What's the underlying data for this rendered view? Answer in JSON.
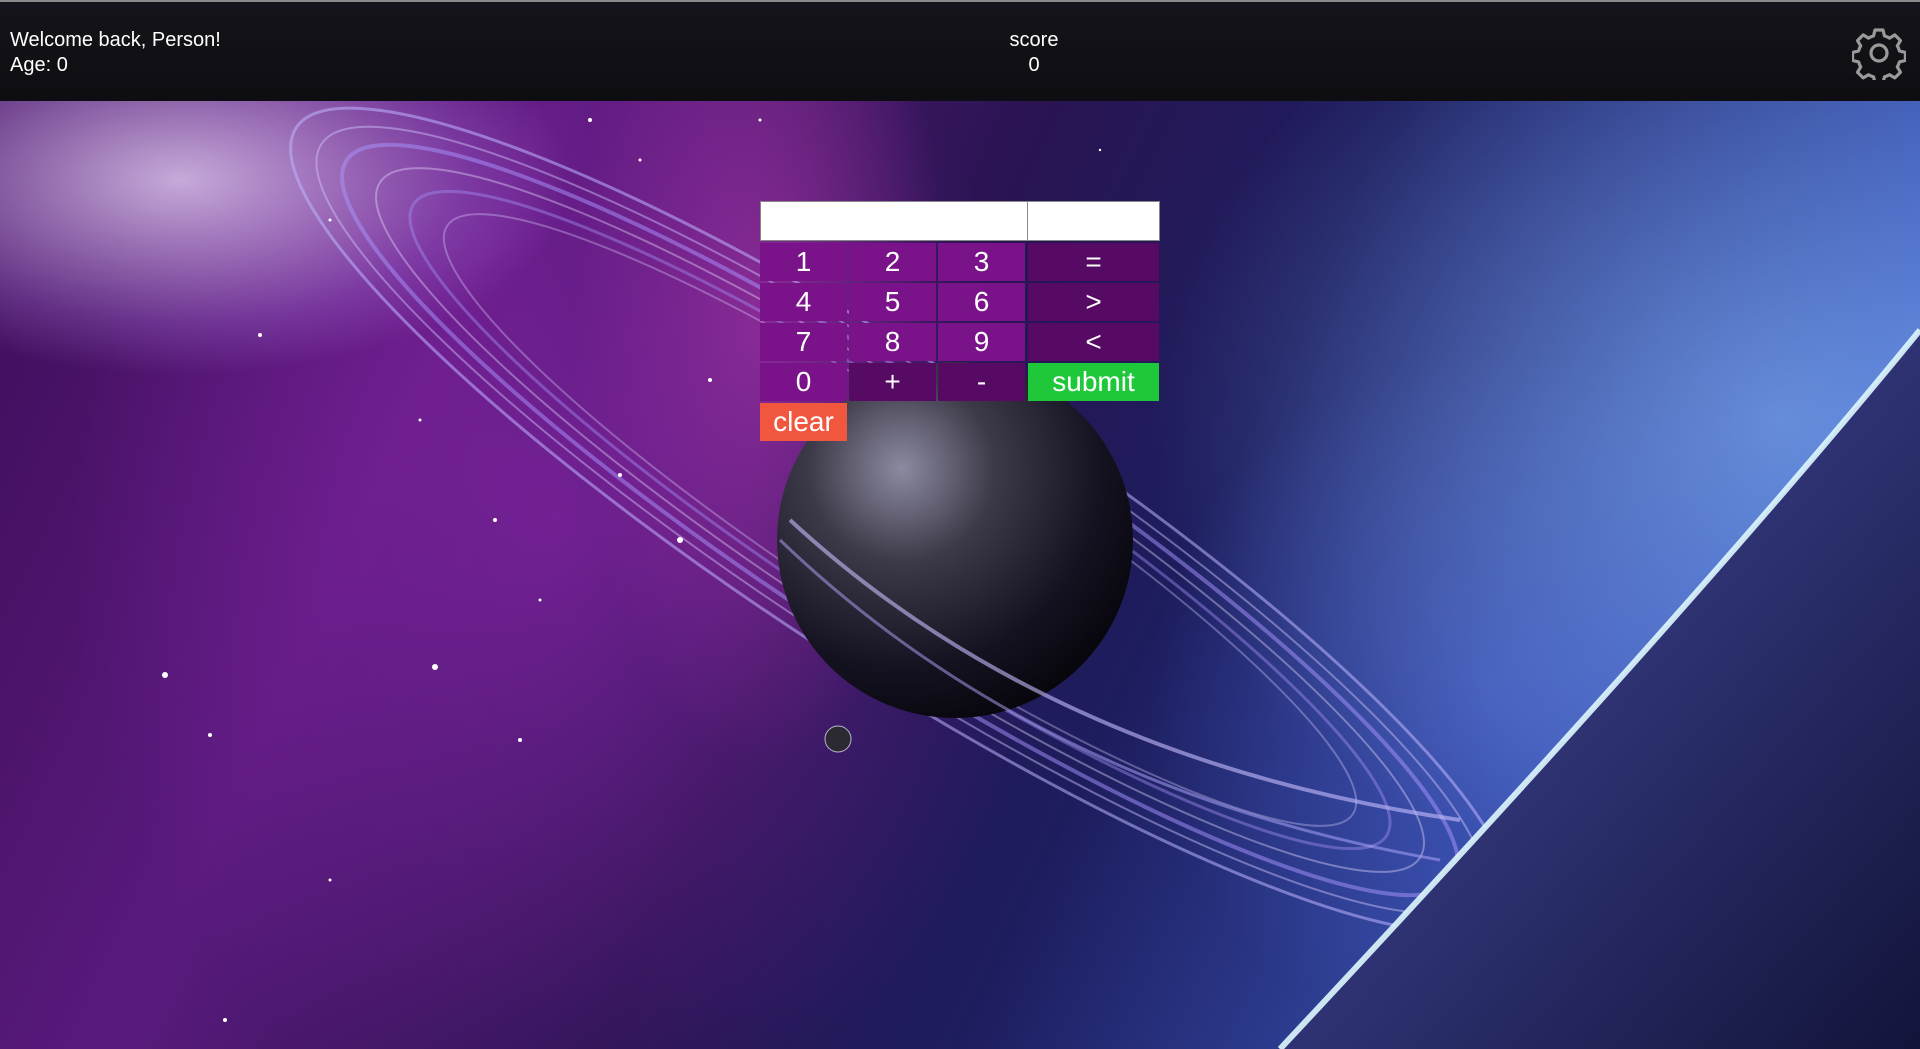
{
  "header": {
    "welcome": "Welcome back, Person!",
    "age": "Age: 0",
    "score_label": "score",
    "score_value": "0",
    "settings_icon": "gear-icon"
  },
  "calculator": {
    "display_main_value": "",
    "display_secondary_value": "",
    "keys": {
      "k1": "1",
      "k2": "2",
      "k3": "3",
      "k4": "4",
      "k5": "5",
      "k6": "6",
      "k7": "7",
      "k8": "8",
      "k9": "9",
      "k0": "0",
      "plus": "+",
      "minus": "-",
      "equals": "=",
      "greater": ">",
      "less": "<",
      "submit": "submit",
      "clear": "clear"
    }
  },
  "colors": {
    "number_key": "#7a1289",
    "operator_key": "#570a63",
    "submit_key": "#1ec83a",
    "clear_key": "#f1573f",
    "header_bg": "#0e0d12"
  }
}
